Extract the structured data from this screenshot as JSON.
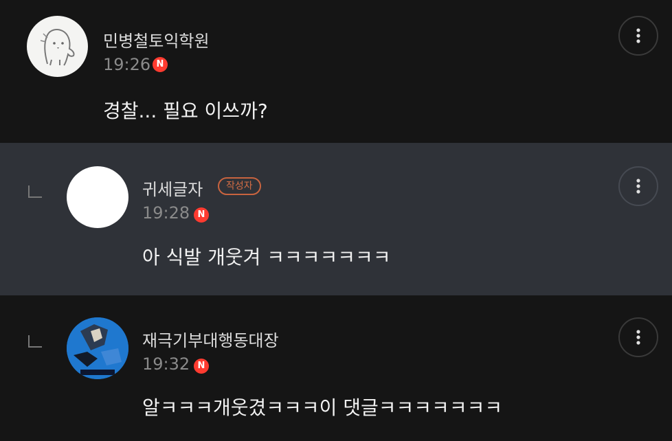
{
  "comments": [
    {
      "username": "민병철토익학원",
      "time": "19:26",
      "badge_letter": "N",
      "text": "경찰... 필요 이쓰까?",
      "avatar_icon": "rabbit-doodle-avatar"
    },
    {
      "username": "귀세글자",
      "author_badge": "작성자",
      "time": "19:28",
      "badge_letter": "N",
      "text": "아 식발 개웃겨 ㅋㅋㅋㅋㅋㅋㅋ",
      "avatar_icon": "blank-white-avatar"
    },
    {
      "username": "재극기부대행동대장",
      "time": "19:32",
      "badge_letter": "N",
      "text": "알ㅋㅋㅋ개웃겼ㅋㅋㅋ이 댓글ㅋㅋㅋㅋㅋㅋㅋ",
      "avatar_icon": "blue-photo-avatar"
    }
  ],
  "colors": {
    "background": "#151515",
    "highlight_row": "#2f3238",
    "new_badge": "#ff3b30",
    "author_badge": "#c9643f"
  },
  "icons": {
    "more": "more-vertical-icon",
    "reply": "reply-indent-icon"
  }
}
